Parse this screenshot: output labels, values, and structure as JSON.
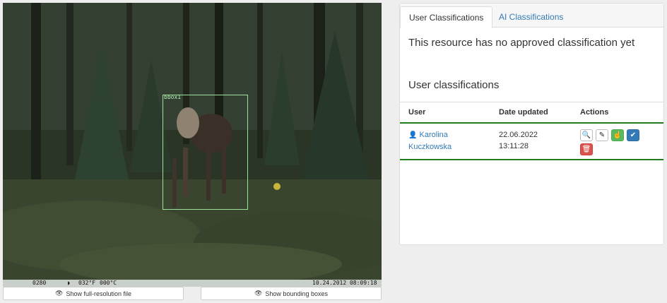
{
  "image": {
    "bbox_label": "bbox1",
    "strip": {
      "counter": "0280",
      "moon": "◗",
      "temp_f": "032°F",
      "temp_c": "000°C",
      "datetime": "10.24.2012 08:09:18"
    },
    "buttons": {
      "full_res": "Show full-resolution file",
      "bboxes": "Show bounding boxes"
    }
  },
  "panel": {
    "tabs": [
      {
        "label": "User Classifications",
        "active": true
      },
      {
        "label": "AI Classifications",
        "active": false
      }
    ],
    "no_approved_message": "This resource has no approved classification yet",
    "section_title": "User classifications",
    "table": {
      "headers": {
        "user": "User",
        "date": "Date updated",
        "actions": "Actions"
      },
      "rows": [
        {
          "user": "Karolina Kuczkowska",
          "date": "22.06.2022",
          "time": "13:11:28"
        }
      ]
    }
  },
  "colors": {
    "link": "#337ab7",
    "table_rule": "#1e7b1e",
    "success": "#5cb85c",
    "primary": "#337ab7",
    "danger": "#d9534f",
    "bbox": "#9be29b"
  }
}
